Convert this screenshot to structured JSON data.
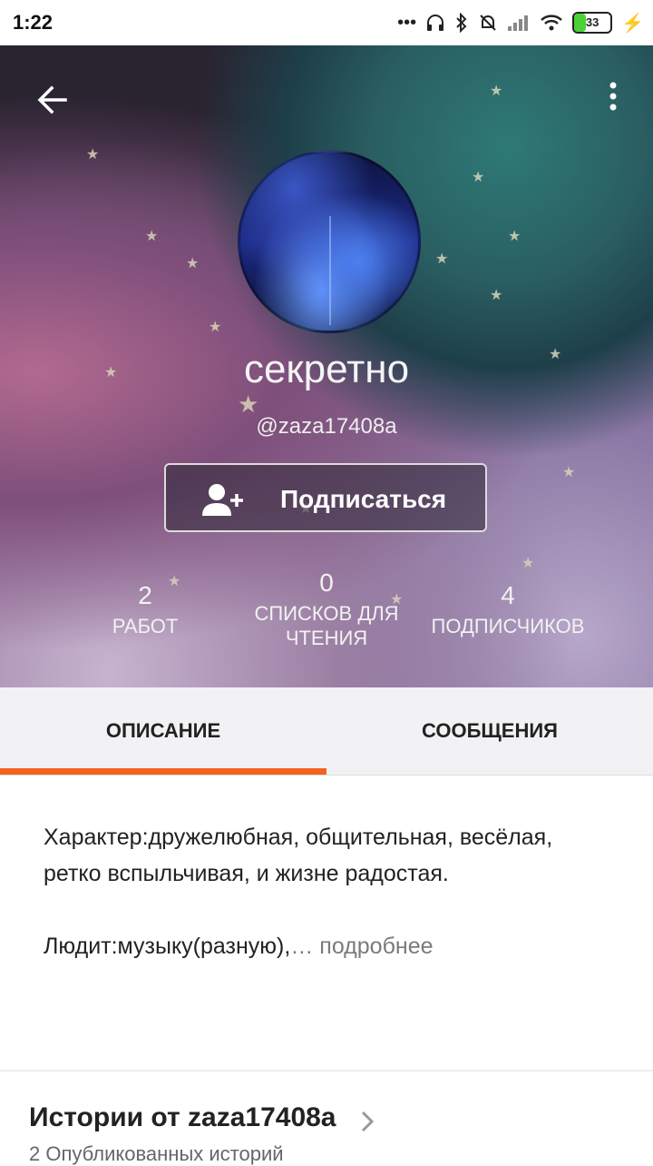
{
  "status_bar": {
    "time": "1:22",
    "battery": "33"
  },
  "profile": {
    "name": "секретно",
    "handle": "@zaza17408a",
    "follow_label": "Подписаться"
  },
  "stats": [
    {
      "value": "2",
      "label": "РАБОТ"
    },
    {
      "value": "0",
      "label": "СПИСКОВ ДЛЯ ЧТЕНИЯ"
    },
    {
      "value": "4",
      "label": "ПОДПИСЧИКОВ"
    }
  ],
  "tabs": [
    {
      "label": "ОПИСАНИЕ",
      "active": true
    },
    {
      "label": "СООБЩЕНИЯ",
      "active": false
    }
  ],
  "description": {
    "paragraph1": "Характер:дружелюбная, общительная, весёлая, ретко вспыльчивая, и жизне радостая.",
    "paragraph2": "Людит:музыку(разную),",
    "ellipsis": "…",
    "more_link": "подробнее"
  },
  "stories": {
    "title": "Истории от zaza17408a",
    "subtitle": "2 Опубликованных историй"
  },
  "colors": {
    "accent": "#f2611d",
    "battery_fill": "#4cd137"
  }
}
